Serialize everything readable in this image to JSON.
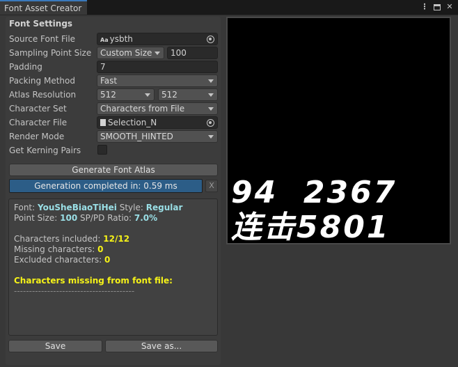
{
  "window": {
    "tab_title": "Font Asset Creator",
    "controls": {
      "menu_icon": "kebab-menu-icon",
      "maximize_icon": "maximize-icon",
      "close_icon": "close-icon"
    }
  },
  "settings": {
    "section_title": "Font Settings",
    "source_font": {
      "label": "Source Font File",
      "value": "ysbth",
      "icon": "font-asset-icon"
    },
    "sampling": {
      "label": "Sampling Point Size",
      "mode": "Custom Size",
      "value": "100"
    },
    "padding": {
      "label": "Padding",
      "value": "7"
    },
    "packing": {
      "label": "Packing Method",
      "value": "Fast"
    },
    "atlas": {
      "label": "Atlas Resolution",
      "width": "512",
      "height": "512"
    },
    "charset": {
      "label": "Character Set",
      "value": "Characters from File"
    },
    "char_file": {
      "label": "Character File",
      "value": "Selection_N",
      "icon": "text-file-icon"
    },
    "render_mode": {
      "label": "Render Mode",
      "value": "SMOOTH_HINTED"
    },
    "kerning": {
      "label": "Get Kerning Pairs",
      "checked": false
    }
  },
  "actions": {
    "generate_label": "Generate Font Atlas",
    "progress_text": "Generation completed in: 0.59 ms",
    "progress_fraction": 1.0,
    "close_label": "X",
    "save_label": "Save",
    "save_as_label": "Save as..."
  },
  "info": {
    "font_label": "Font:",
    "font_name": "YouSheBiaoTiHei",
    "style_label": "Style:",
    "style_value": "Regular",
    "point_size_label": "Point Size:",
    "point_size_value": "100",
    "ratio_label": "SP/PD Ratio:",
    "ratio_value": "7.0%",
    "chars_included_label": "Characters included:",
    "chars_included_value": "12/12",
    "missing_label": "Missing characters:",
    "missing_value": "0",
    "excluded_label": "Excluded characters:",
    "excluded_value": "0",
    "missing_header": "Characters missing from font file:",
    "separator": "----------------------------------------"
  },
  "preview": {
    "line1": "94  2367",
    "line2": "连击5801"
  },
  "colors": {
    "accent": "#3a79bb",
    "progress_fill": "#2c5d87",
    "info_cyan": "#9adfe6",
    "info_yellow": "#f5f218"
  }
}
